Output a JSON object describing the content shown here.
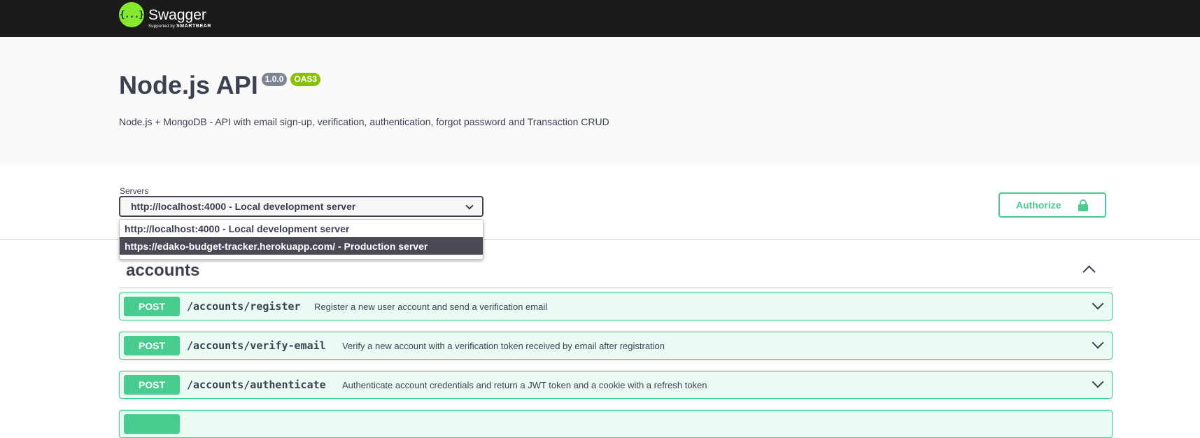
{
  "topbar": {
    "logo_glyph": "{...}",
    "logo_name": "Swagger",
    "logo_tm": ".",
    "logo_sub_prefix": "Supported by",
    "logo_sub_brand": "SMARTBEAR"
  },
  "info": {
    "title": "Node.js API",
    "version": "1.0.0",
    "oas": "OAS3",
    "description": "Node.js + MongoDB - API with email sign-up, verification, authentication, forgot password and Transaction CRUD"
  },
  "servers": {
    "label": "Servers",
    "selected": "http://localhost:4000 - Local development server",
    "options": [
      "http://localhost:4000 - Local development server",
      "https://edako-budget-tracker.herokuapp.com/ - Production server"
    ],
    "highlighted_index": 1
  },
  "authorize": {
    "label": "Authorize",
    "icon": "lock-icon"
  },
  "tag": {
    "name": "accounts",
    "operations": [
      {
        "method": "POST",
        "path": "/accounts/register",
        "summary": "Register a new user account and send a verification email"
      },
      {
        "method": "POST",
        "path": "/accounts/verify-email",
        "summary": "Verify a new account with a verification token received by email after registration"
      },
      {
        "method": "POST",
        "path": "/accounts/authenticate",
        "summary": "Authenticate account credentials and return a JWT token and a cookie with a refresh token"
      }
    ]
  },
  "colors": {
    "topbar": "#1b1b1b",
    "logo_green": "#85ea2d",
    "post": "#49cc90",
    "version_badge": "#7d8492",
    "oas_badge": "#89bf04"
  }
}
